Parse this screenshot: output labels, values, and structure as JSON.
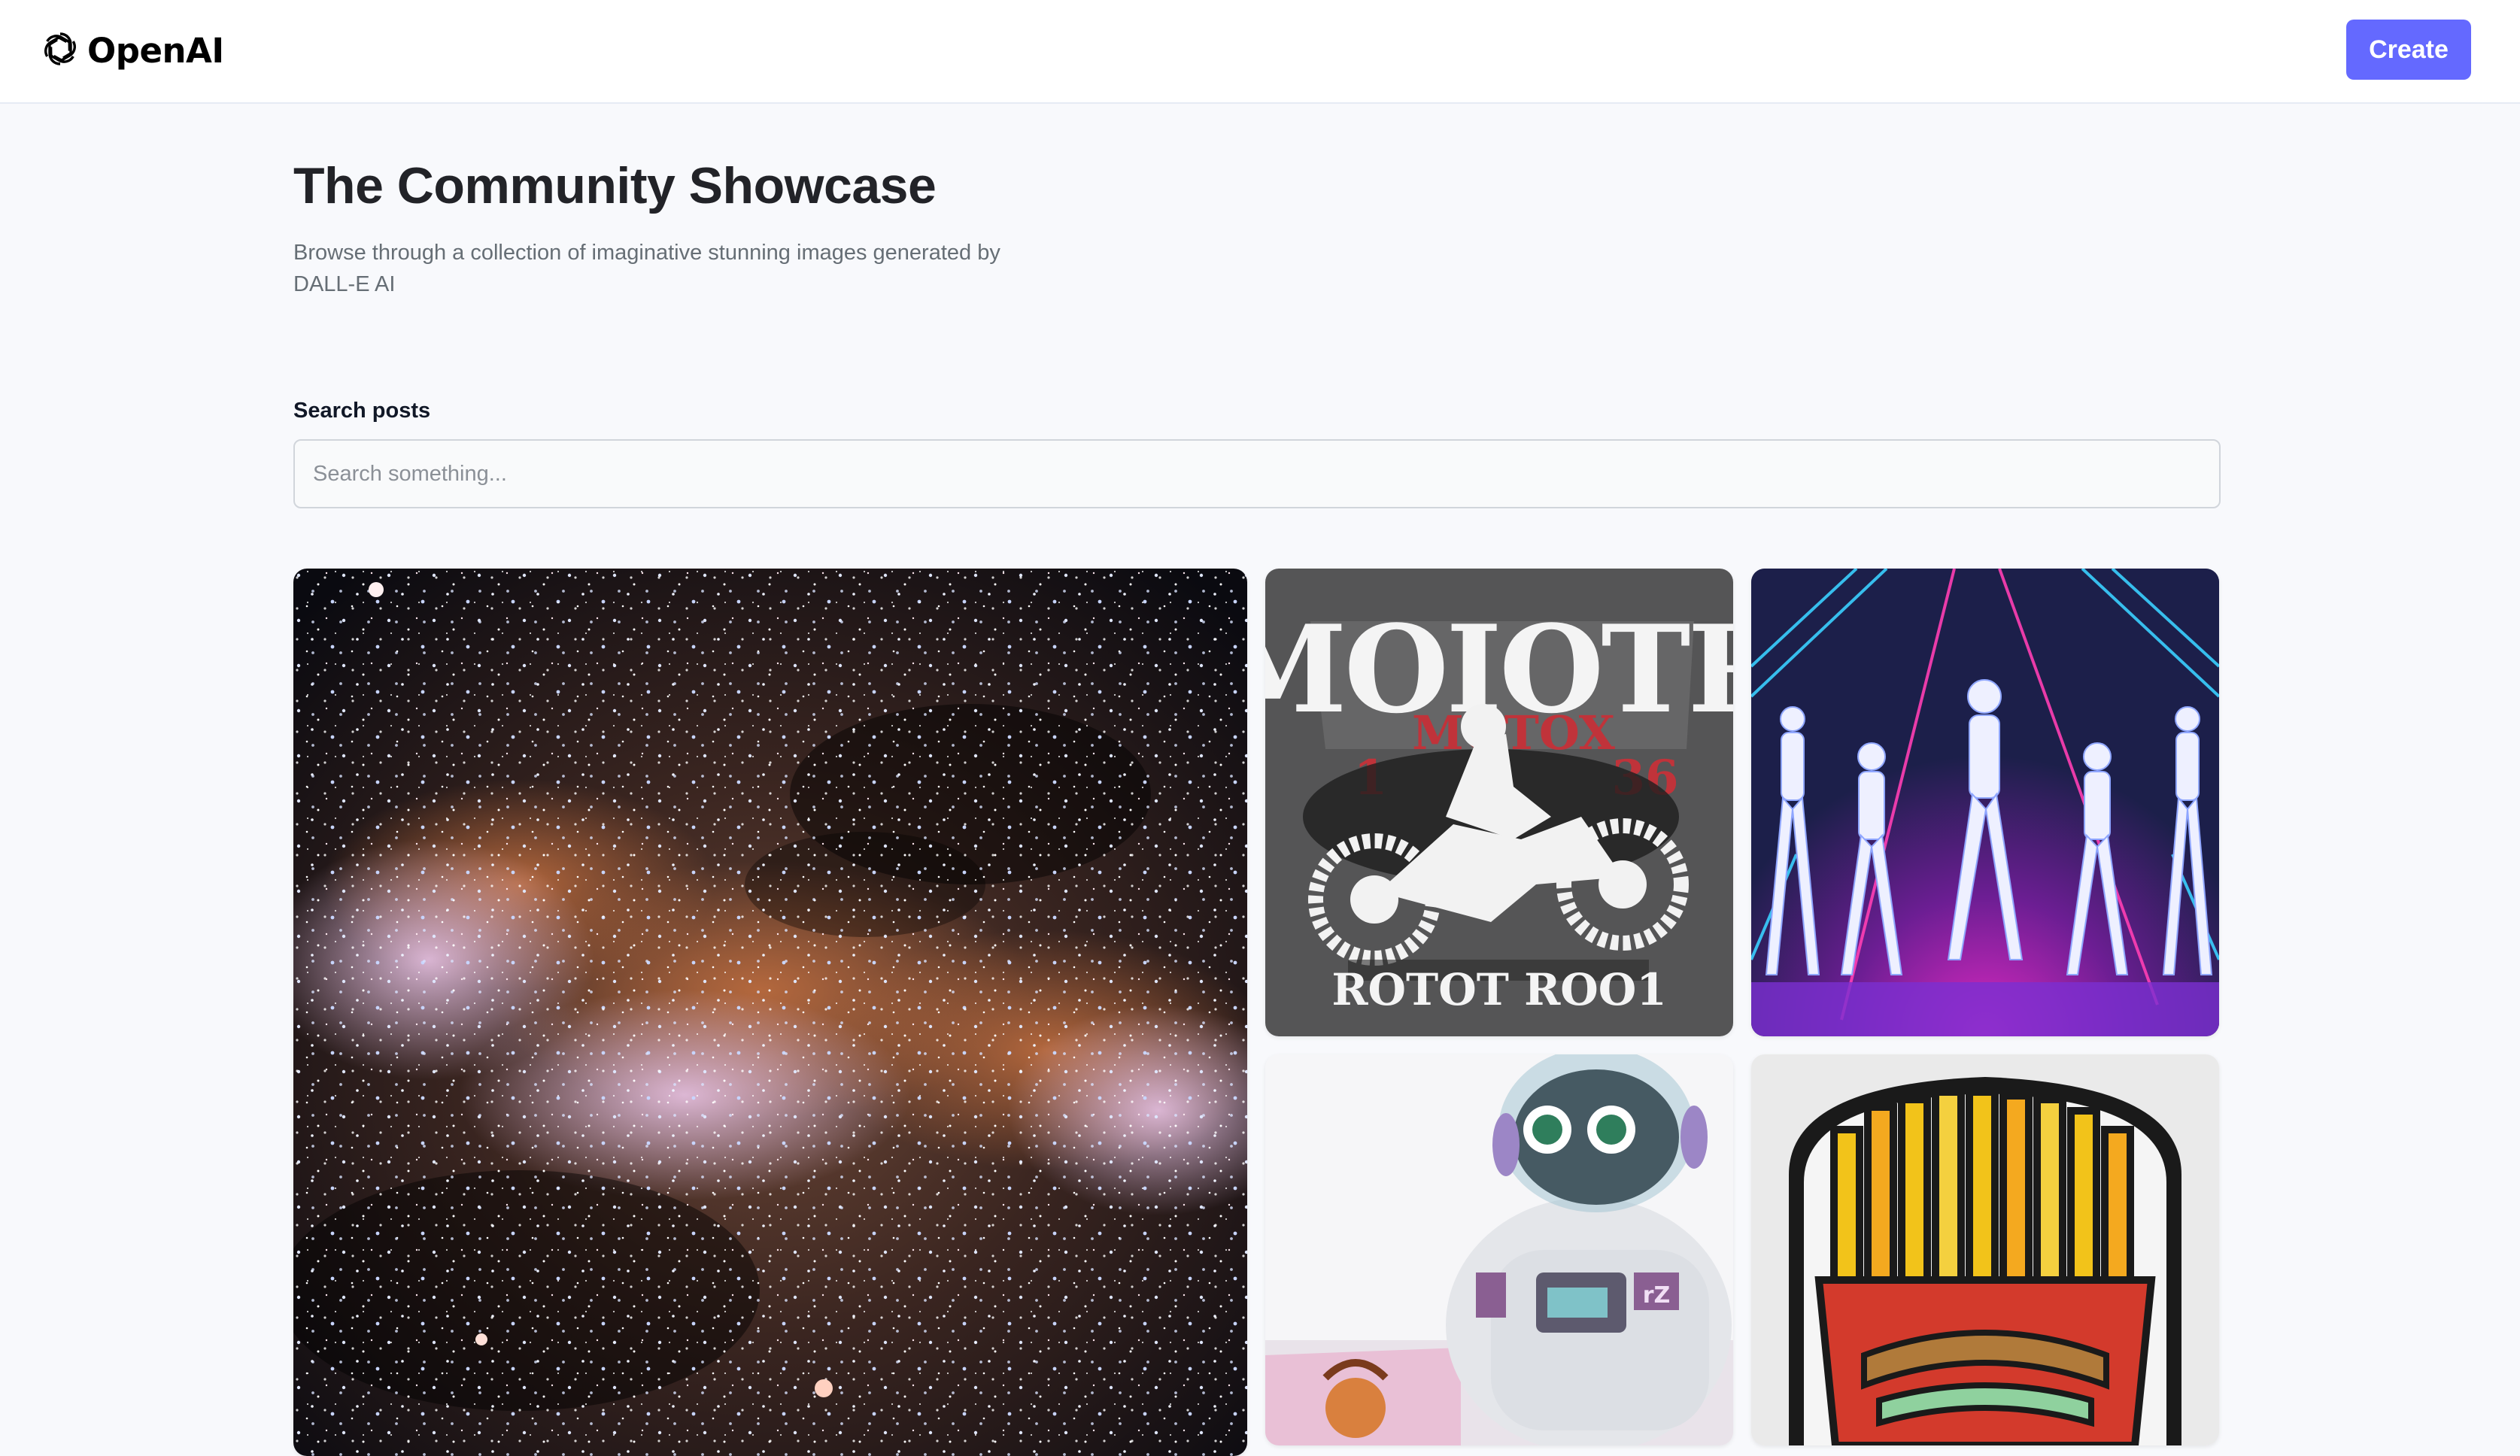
{
  "header": {
    "brand": "OpenAI",
    "logo_icon": "openai-logo-icon",
    "create_label": "Create",
    "accent_color": "#6469ff"
  },
  "intro": {
    "title": "The Community Showcase",
    "subtitle": "Browse through a collection of imaginative stunning images generated by DALL-E AI"
  },
  "search": {
    "label": "Search posts",
    "placeholder": "Search something...",
    "value": ""
  },
  "gallery": {
    "cards": [
      {
        "name": "galaxy-image"
      },
      {
        "name": "motocross-shirt-image",
        "texts": [
          "MOIOTR",
          "MOTOX",
          "1",
          "36",
          "ROTOT ROO1"
        ]
      },
      {
        "name": "neon-dancers-image"
      },
      {
        "name": "astronaut-robot-image",
        "texts": [
          "rZ"
        ]
      },
      {
        "name": "stained-glass-fries-image"
      }
    ]
  }
}
